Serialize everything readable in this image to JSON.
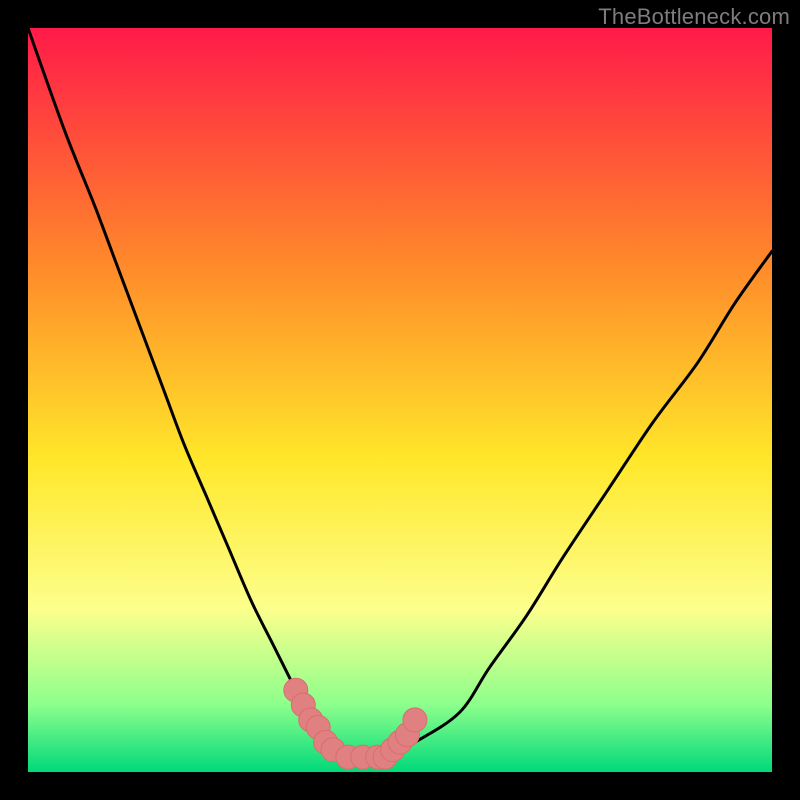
{
  "watermark": {
    "text": "TheBottleneck.com"
  },
  "colors": {
    "frame": "#000000",
    "gradient_top": "#ff1a49",
    "gradient_mid_upper": "#ff8a2a",
    "gradient_mid": "#ffe72a",
    "gradient_mid_lower": "#fdff8c",
    "gradient_lower": "#8cff8c",
    "gradient_bottom": "#00d97a",
    "curve_stroke": "#000000",
    "marker_fill": "#e08080",
    "marker_stroke": "#d66f6f"
  },
  "chart_data": {
    "type": "line",
    "title": "",
    "xlabel": "",
    "ylabel": "",
    "xlim": [
      0,
      100
    ],
    "ylim": [
      0,
      100
    ],
    "grid": false,
    "series": [
      {
        "name": "bottleneck-curve",
        "x": [
          0,
          5,
          9,
          12,
          15,
          18,
          21,
          24,
          27,
          30,
          33,
          36,
          38,
          40,
          43,
          48,
          52,
          58,
          62,
          67,
          72,
          78,
          84,
          90,
          95,
          100
        ],
        "values": [
          100,
          86,
          76,
          68,
          60,
          52,
          44,
          37,
          30,
          23,
          17,
          11,
          7,
          4,
          2,
          2,
          4,
          8,
          14,
          21,
          29,
          38,
          47,
          55,
          63,
          70
        ]
      }
    ],
    "markers": {
      "name": "highlighted-range",
      "x": [
        36,
        37,
        38,
        39,
        40,
        41,
        43,
        45,
        47,
        48,
        49,
        50,
        51,
        52
      ],
      "values": [
        11,
        9,
        7,
        6,
        4,
        3,
        2,
        2,
        2,
        2,
        3,
        4,
        5,
        7
      ]
    },
    "annotations": []
  }
}
